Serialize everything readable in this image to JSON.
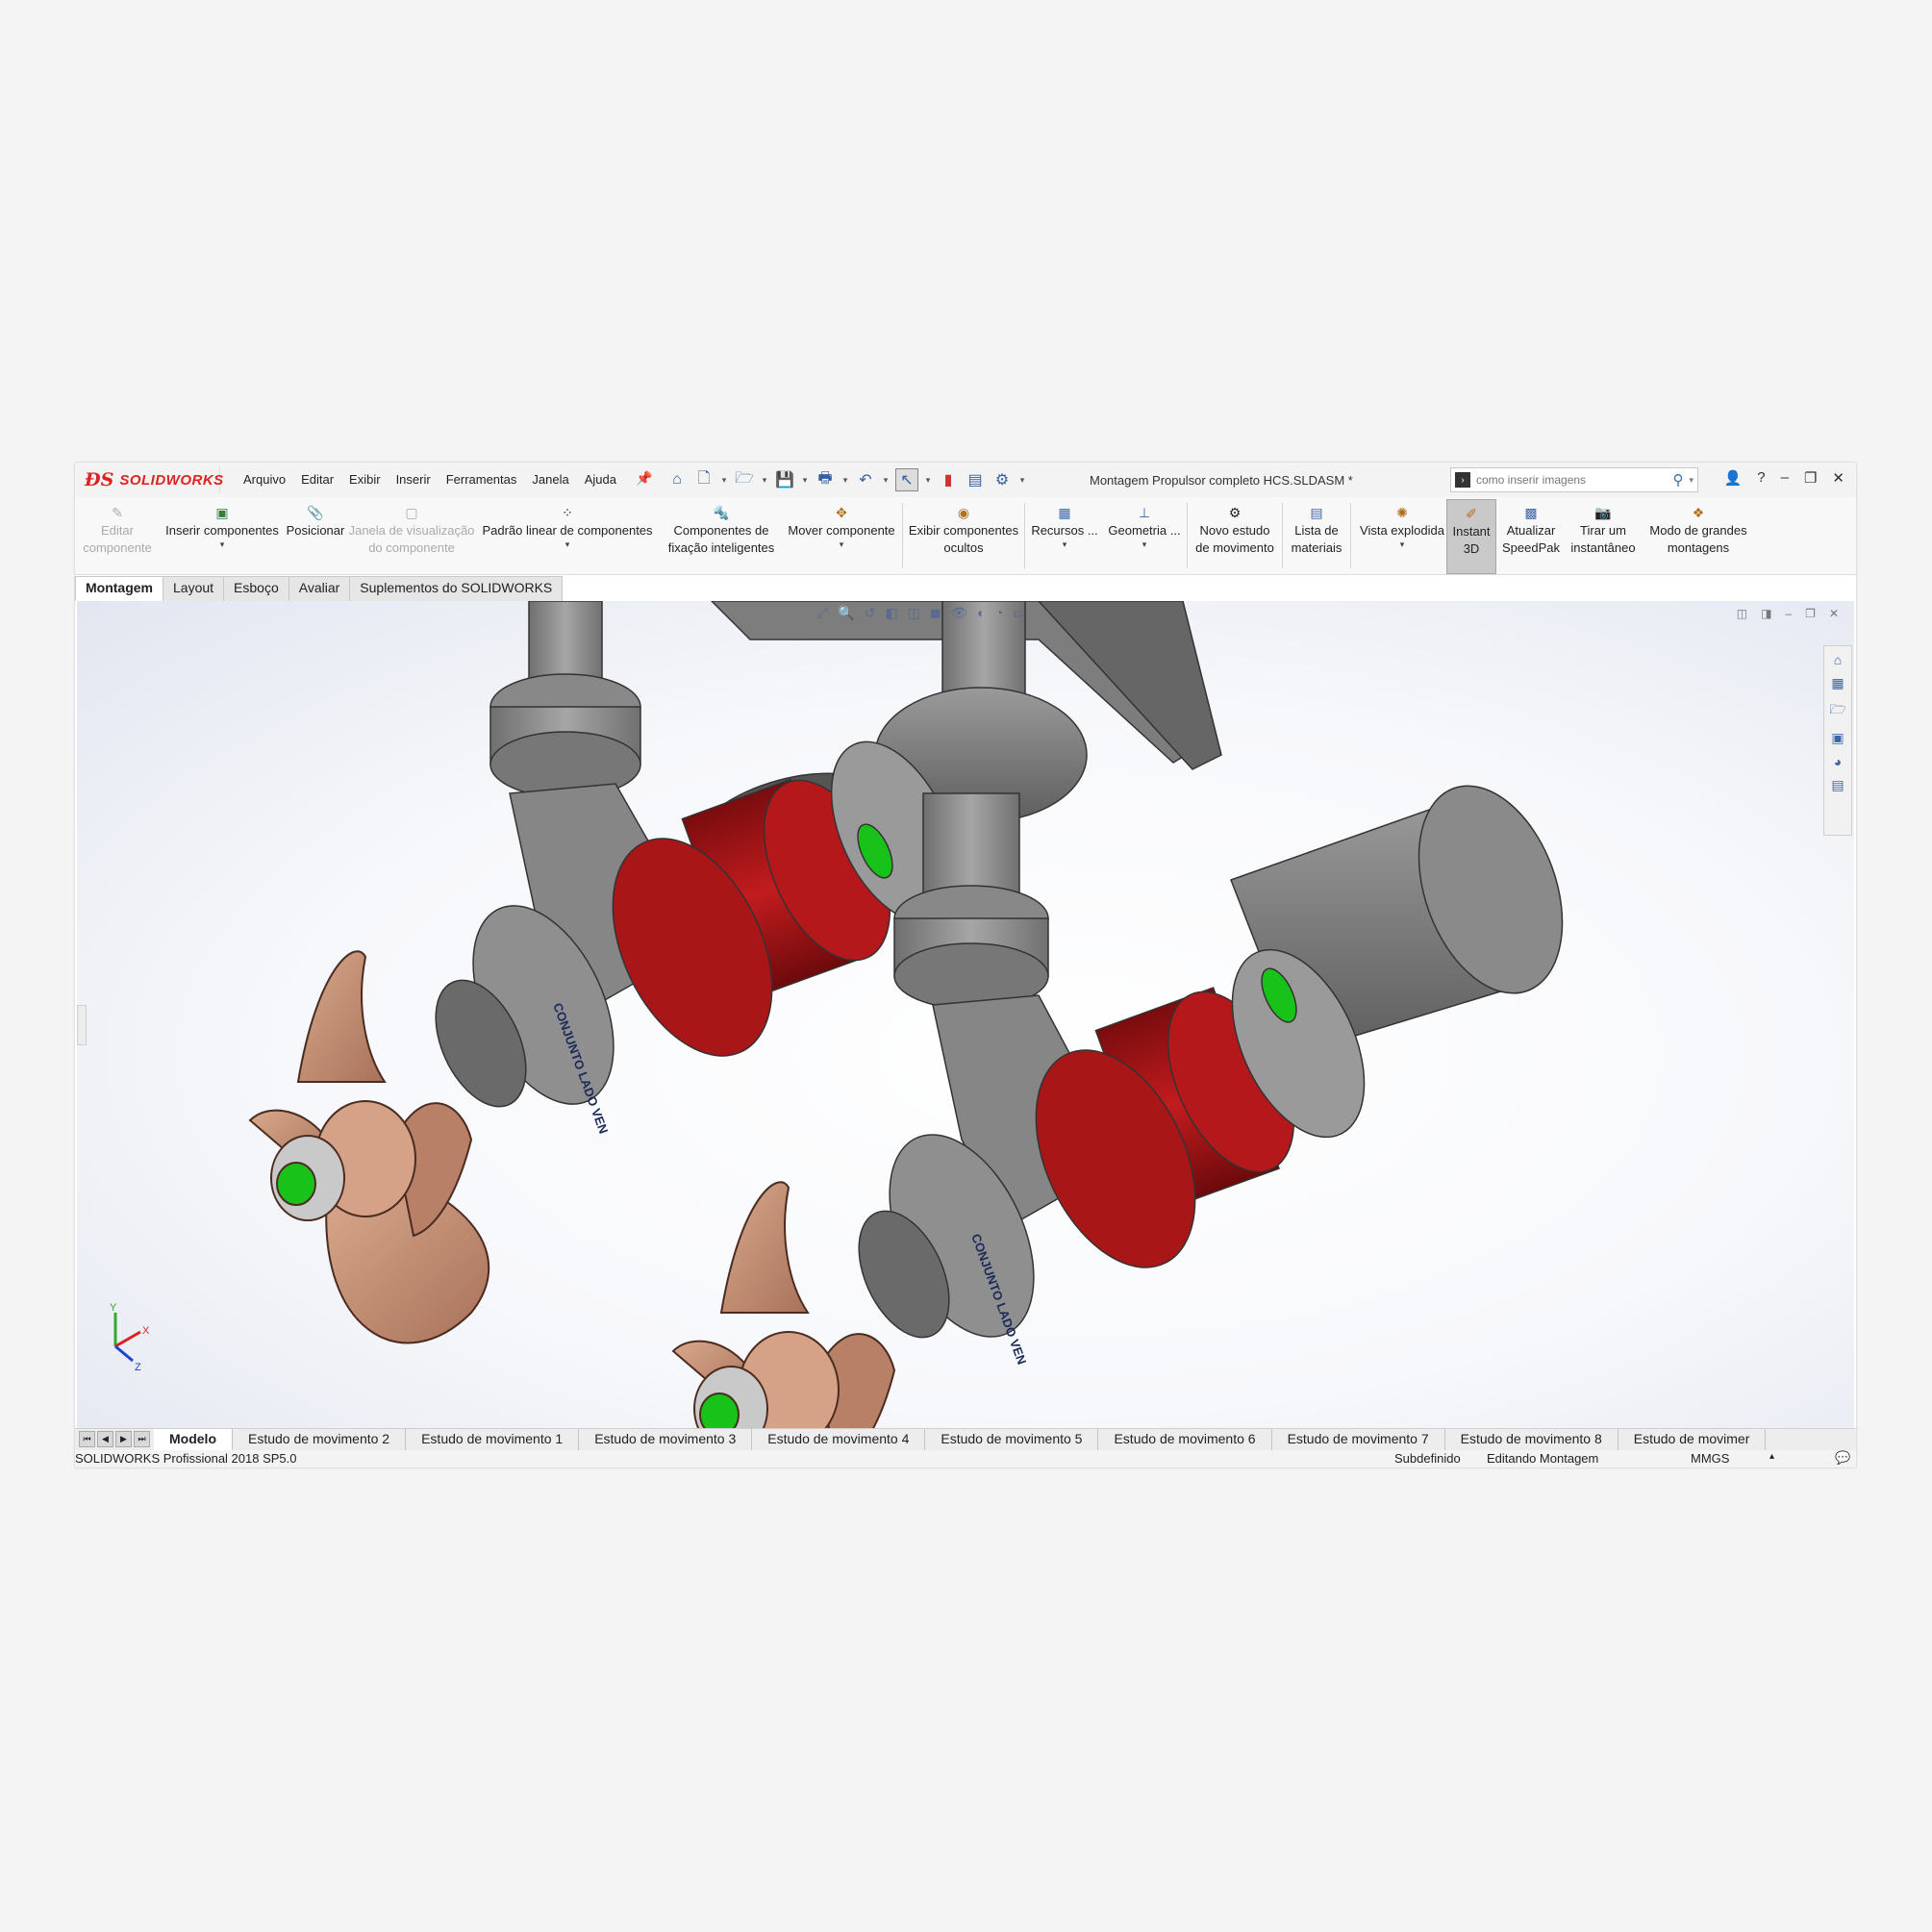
{
  "app": {
    "brand": "SOLIDWORKS",
    "brand_color": "#d22b2b",
    "version": "SOLIDWORKS Profissional 2018 SP5.0"
  },
  "menu": [
    "Arquivo",
    "Editar",
    "Exibir",
    "Inserir",
    "Ferramentas",
    "Janela",
    "Ajuda"
  ],
  "document_title": "Montagem Propulsor completo HCS.SLDASM *",
  "search": {
    "placeholder": "como inserir imagens"
  },
  "commands": [
    {
      "label1": "Editar",
      "label2": "componente",
      "icon": "edit-component-icon",
      "disabled": true
    },
    {
      "label1": "Inserir componentes",
      "label2": "",
      "icon": "insert-components-icon",
      "caret": true
    },
    {
      "label1": "Posicionar",
      "label2": "",
      "icon": "mate-icon"
    },
    {
      "label1": "Janela de visualização",
      "label2": "do componente",
      "icon": "component-preview-icon",
      "disabled": true
    },
    {
      "label1": "Padrão linear de componentes",
      "label2": "",
      "icon": "linear-pattern-icon",
      "caret": true
    },
    {
      "label1": "Componentes de",
      "label2": "fixação inteligentes",
      "icon": "smart-fasteners-icon"
    },
    {
      "label1": "Mover componente",
      "label2": "",
      "icon": "move-component-icon",
      "caret": true
    },
    {
      "label1": "Exibir componentes",
      "label2": "ocultos",
      "icon": "show-hidden-icon"
    },
    {
      "label1": "Recursos ...",
      "label2": "",
      "icon": "features-icon",
      "caret": true
    },
    {
      "label1": "Geometria ...",
      "label2": "",
      "icon": "reference-geometry-icon",
      "caret": true
    },
    {
      "label1": "Novo estudo",
      "label2": "de movimento",
      "icon": "motion-study-icon"
    },
    {
      "label1": "Lista de",
      "label2": "materiais",
      "icon": "bill-of-materials-icon"
    },
    {
      "label1": "Vista explodida",
      "label2": "",
      "icon": "exploded-view-icon",
      "caret": true
    },
    {
      "label1": "Instant",
      "label2": "3D",
      "icon": "instant3d-icon",
      "active": true
    },
    {
      "label1": "Atualizar",
      "label2": "SpeedPak",
      "icon": "speedpak-icon"
    },
    {
      "label1": "Tirar um",
      "label2": "instantâneo",
      "icon": "snapshot-icon"
    },
    {
      "label1": "Modo de grandes",
      "label2": "montagens",
      "icon": "large-assembly-icon"
    }
  ],
  "tabs": [
    "Montagem",
    "Layout",
    "Esboço",
    "Avaliar",
    "Suplementos do SOLIDWORKS"
  ],
  "model": {
    "colors": {
      "flange_red": "#b0181a",
      "steel": "#8d8d8d",
      "propeller": "#c8947a",
      "shaft_green": "#19c219"
    },
    "engraving": "CONJUNTO LADO VEN",
    "triad": {
      "x": "X",
      "y": "Y",
      "z": "Z"
    }
  },
  "motion_tabs": [
    "Modelo",
    "Estudo de movimento 2",
    "Estudo de movimento 1",
    "Estudo de movimento 3",
    "Estudo de movimento 4",
    "Estudo de movimento 5",
    "Estudo de movimento 6",
    "Estudo de movimento 7",
    "Estudo de movimento 8",
    "Estudo de movimer"
  ],
  "status": {
    "state": "Subdefinido",
    "mode": "Editando Montagem",
    "units": "MMGS",
    "units_caret": "▴"
  }
}
